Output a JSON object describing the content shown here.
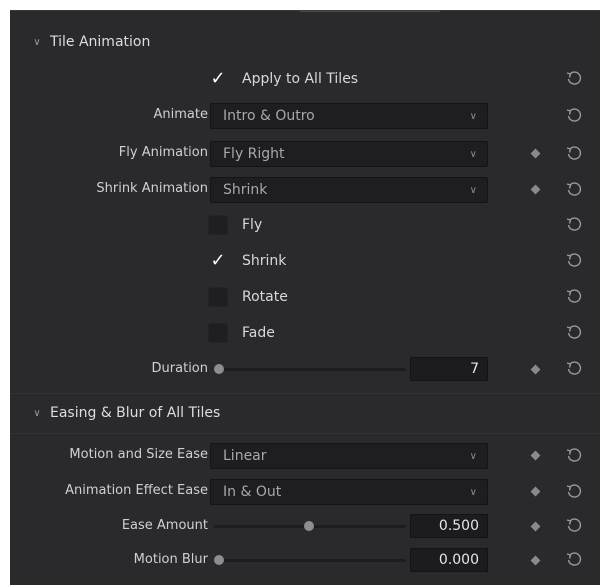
{
  "tile_animation": {
    "header": "Tile Animation",
    "apply_all_label": "Apply to All Tiles",
    "apply_all_checked": true,
    "animate": {
      "label": "Animate",
      "value": "Intro & Outro"
    },
    "fly_animation": {
      "label": "Fly Animation",
      "value": "Fly Right"
    },
    "shrink_animation": {
      "label": "Shrink Animation",
      "value": "Shrink"
    },
    "options": [
      {
        "label": "Fly",
        "checked": false
      },
      {
        "label": "Shrink",
        "checked": true
      },
      {
        "label": "Rotate",
        "checked": false
      },
      {
        "label": "Fade",
        "checked": false
      }
    ],
    "duration": {
      "label": "Duration",
      "value": "7",
      "slider_fraction": 0.0
    }
  },
  "easing": {
    "header": "Easing & Blur of All Tiles",
    "motion_size_ease": {
      "label": "Motion and Size Ease",
      "value": "Linear"
    },
    "effect_ease": {
      "label": "Animation Effect Ease",
      "value": "In & Out"
    },
    "ease_amount": {
      "label": "Ease Amount",
      "value": "0.500",
      "slider_fraction": 0.5
    },
    "motion_blur": {
      "label": "Motion Blur",
      "value": "0.000",
      "slider_fraction": 0.0
    }
  },
  "icons": {
    "reset": "reset-arrow-icon",
    "keyframe": "keyframe-diamond-icon",
    "chevron": "chevron-down-icon",
    "check": "checkmark-icon"
  },
  "colors": {
    "panel": "#2a2a2d",
    "field": "#1e1e20",
    "text": "#d6d6d6"
  }
}
